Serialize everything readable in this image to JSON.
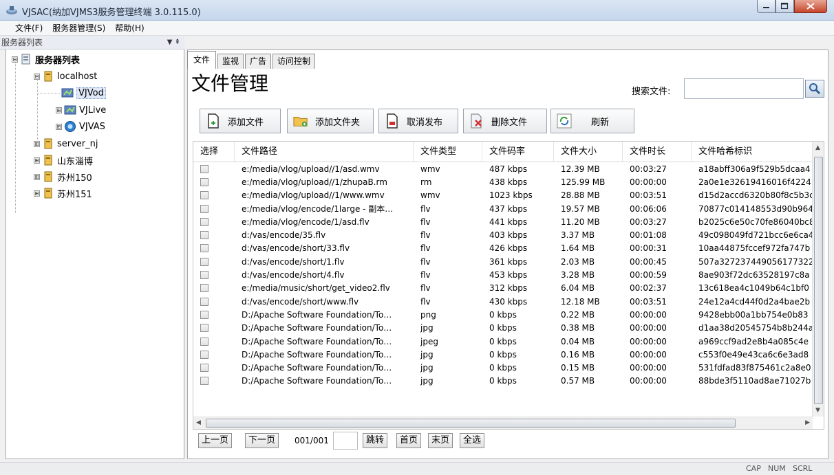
{
  "window": {
    "title": "VJSAC(纳加VJMS3服务管理终端 3.0.115.0)"
  },
  "menu": {
    "items": [
      "文件(F)",
      "服务器管理(S)",
      "帮助(H)"
    ]
  },
  "sidebar": {
    "header": "服务器列表",
    "pin": "▼ ⇞",
    "tree": [
      {
        "label": "服务器列表",
        "expander": "⊟"
      },
      {
        "label": "localhost",
        "expander": "⊟"
      },
      {
        "label": "VJVod",
        "expander": ""
      },
      {
        "label": "VJLive",
        "expander": "⊞"
      },
      {
        "label": "VJVAS",
        "expander": "⊞"
      },
      {
        "label": "server_nj",
        "expander": "⊞"
      },
      {
        "label": "山东淄博",
        "expander": "⊞"
      },
      {
        "label": "苏州150",
        "expander": "⊞"
      },
      {
        "label": "苏州151",
        "expander": "⊞"
      }
    ]
  },
  "tabs": [
    "文件",
    "监视",
    "广告",
    "访问控制"
  ],
  "main": {
    "title": "文件管理",
    "search_label": "搜索文件:",
    "search_value": "",
    "toolbar": [
      "添加文件",
      "添加文件夹",
      "取消发布",
      "删除文件",
      "刷新"
    ]
  },
  "table": {
    "columns": [
      "选择",
      "文件路径",
      "文件类型",
      "文件码率",
      "文件大小",
      "文件时长",
      "文件哈希标识"
    ],
    "rows": [
      [
        "e:/media/vlog/upload//1/asd.wmv",
        "wmv",
        "487 kbps",
        "12.39 MB",
        "00:03:27",
        "a18abff306a9f529b5dcaa4"
      ],
      [
        "e:/media/vlog/upload//1/zhupaB.rm",
        "rm",
        "438 kbps",
        "125.99 MB",
        "00:00:00",
        "2a0e1e32619416016f4224"
      ],
      [
        "e:/media/vlog/upload//1/www.wmv",
        "wmv",
        "1023 kbps",
        "28.88 MB",
        "00:03:51",
        "d15d2accd6320b80f8c5b3c"
      ],
      [
        "e:/media/vlog/encode/1large - 副本…",
        "flv",
        "437 kbps",
        "19.57 MB",
        "00:06:06",
        "70877c014148553d90b964"
      ],
      [
        "e:/media/vlog/encode/1/asd.flv",
        "flv",
        "441 kbps",
        "11.20 MB",
        "00:03:27",
        "b2025c6e50c70fe86040bc8"
      ],
      [
        "d:/vas/encode/35.flv",
        "flv",
        "403 kbps",
        "3.37 MB",
        "00:01:08",
        "49c098049fd721bcc6e6ca4"
      ],
      [
        "d:/vas/encode/short/33.flv",
        "flv",
        "426 kbps",
        "1.64 MB",
        "00:00:31",
        "10aa44875fccef972fa747b"
      ],
      [
        "d:/vas/encode/short/1.flv",
        "flv",
        "361 kbps",
        "2.03 MB",
        "00:00:45",
        "507a327237449056177322"
      ],
      [
        "d:/vas/encode/short/4.flv",
        "flv",
        "453 kbps",
        "3.28 MB",
        "00:00:59",
        "8ae903f72dc63528197c8a"
      ],
      [
        "e:/media/music/short/get_video2.flv",
        "flv",
        "312 kbps",
        "6.04 MB",
        "00:02:37",
        "13c618ea4c1049b64c1bf0"
      ],
      [
        "d:/vas/encode/short/www.flv",
        "flv",
        "430 kbps",
        "12.18 MB",
        "00:03:51",
        "24e12a4cd44f0d2a4bae2b"
      ],
      [
        "D:/Apache Software Foundation/To…",
        "png",
        "0 kbps",
        "0.22 MB",
        "00:00:00",
        "9428ebb00a1bb754e0b83"
      ],
      [
        "D:/Apache Software Foundation/To…",
        "jpg",
        "0 kbps",
        "0.38 MB",
        "00:00:00",
        "d1aa38d20545754b8b244a"
      ],
      [
        "D:/Apache Software Foundation/To…",
        "jpeg",
        "0 kbps",
        "0.04 MB",
        "00:00:00",
        "a969ccf9ad2e8b4a085c4e"
      ],
      [
        "D:/Apache Software Foundation/To…",
        "jpg",
        "0 kbps",
        "0.16 MB",
        "00:00:00",
        "c553f0e49e43ca6c6e3ad8"
      ],
      [
        "D:/Apache Software Foundation/To…",
        "jpg",
        "0 kbps",
        "0.15 MB",
        "00:00:00",
        "531fdfad83f875461c2a8e0"
      ],
      [
        "D:/Apache Software Foundation/To…",
        "jpg",
        "0 kbps",
        "0.57 MB",
        "00:00:00",
        "88bde3f5110ad8ae71027b"
      ]
    ]
  },
  "pager": {
    "prev": "上一页",
    "next": "下一页",
    "page": "001/001",
    "jump": "跳转",
    "first": "首页",
    "last": "末页",
    "select_all": "全选"
  },
  "status": [
    "CAP",
    "NUM",
    "SCRL"
  ]
}
